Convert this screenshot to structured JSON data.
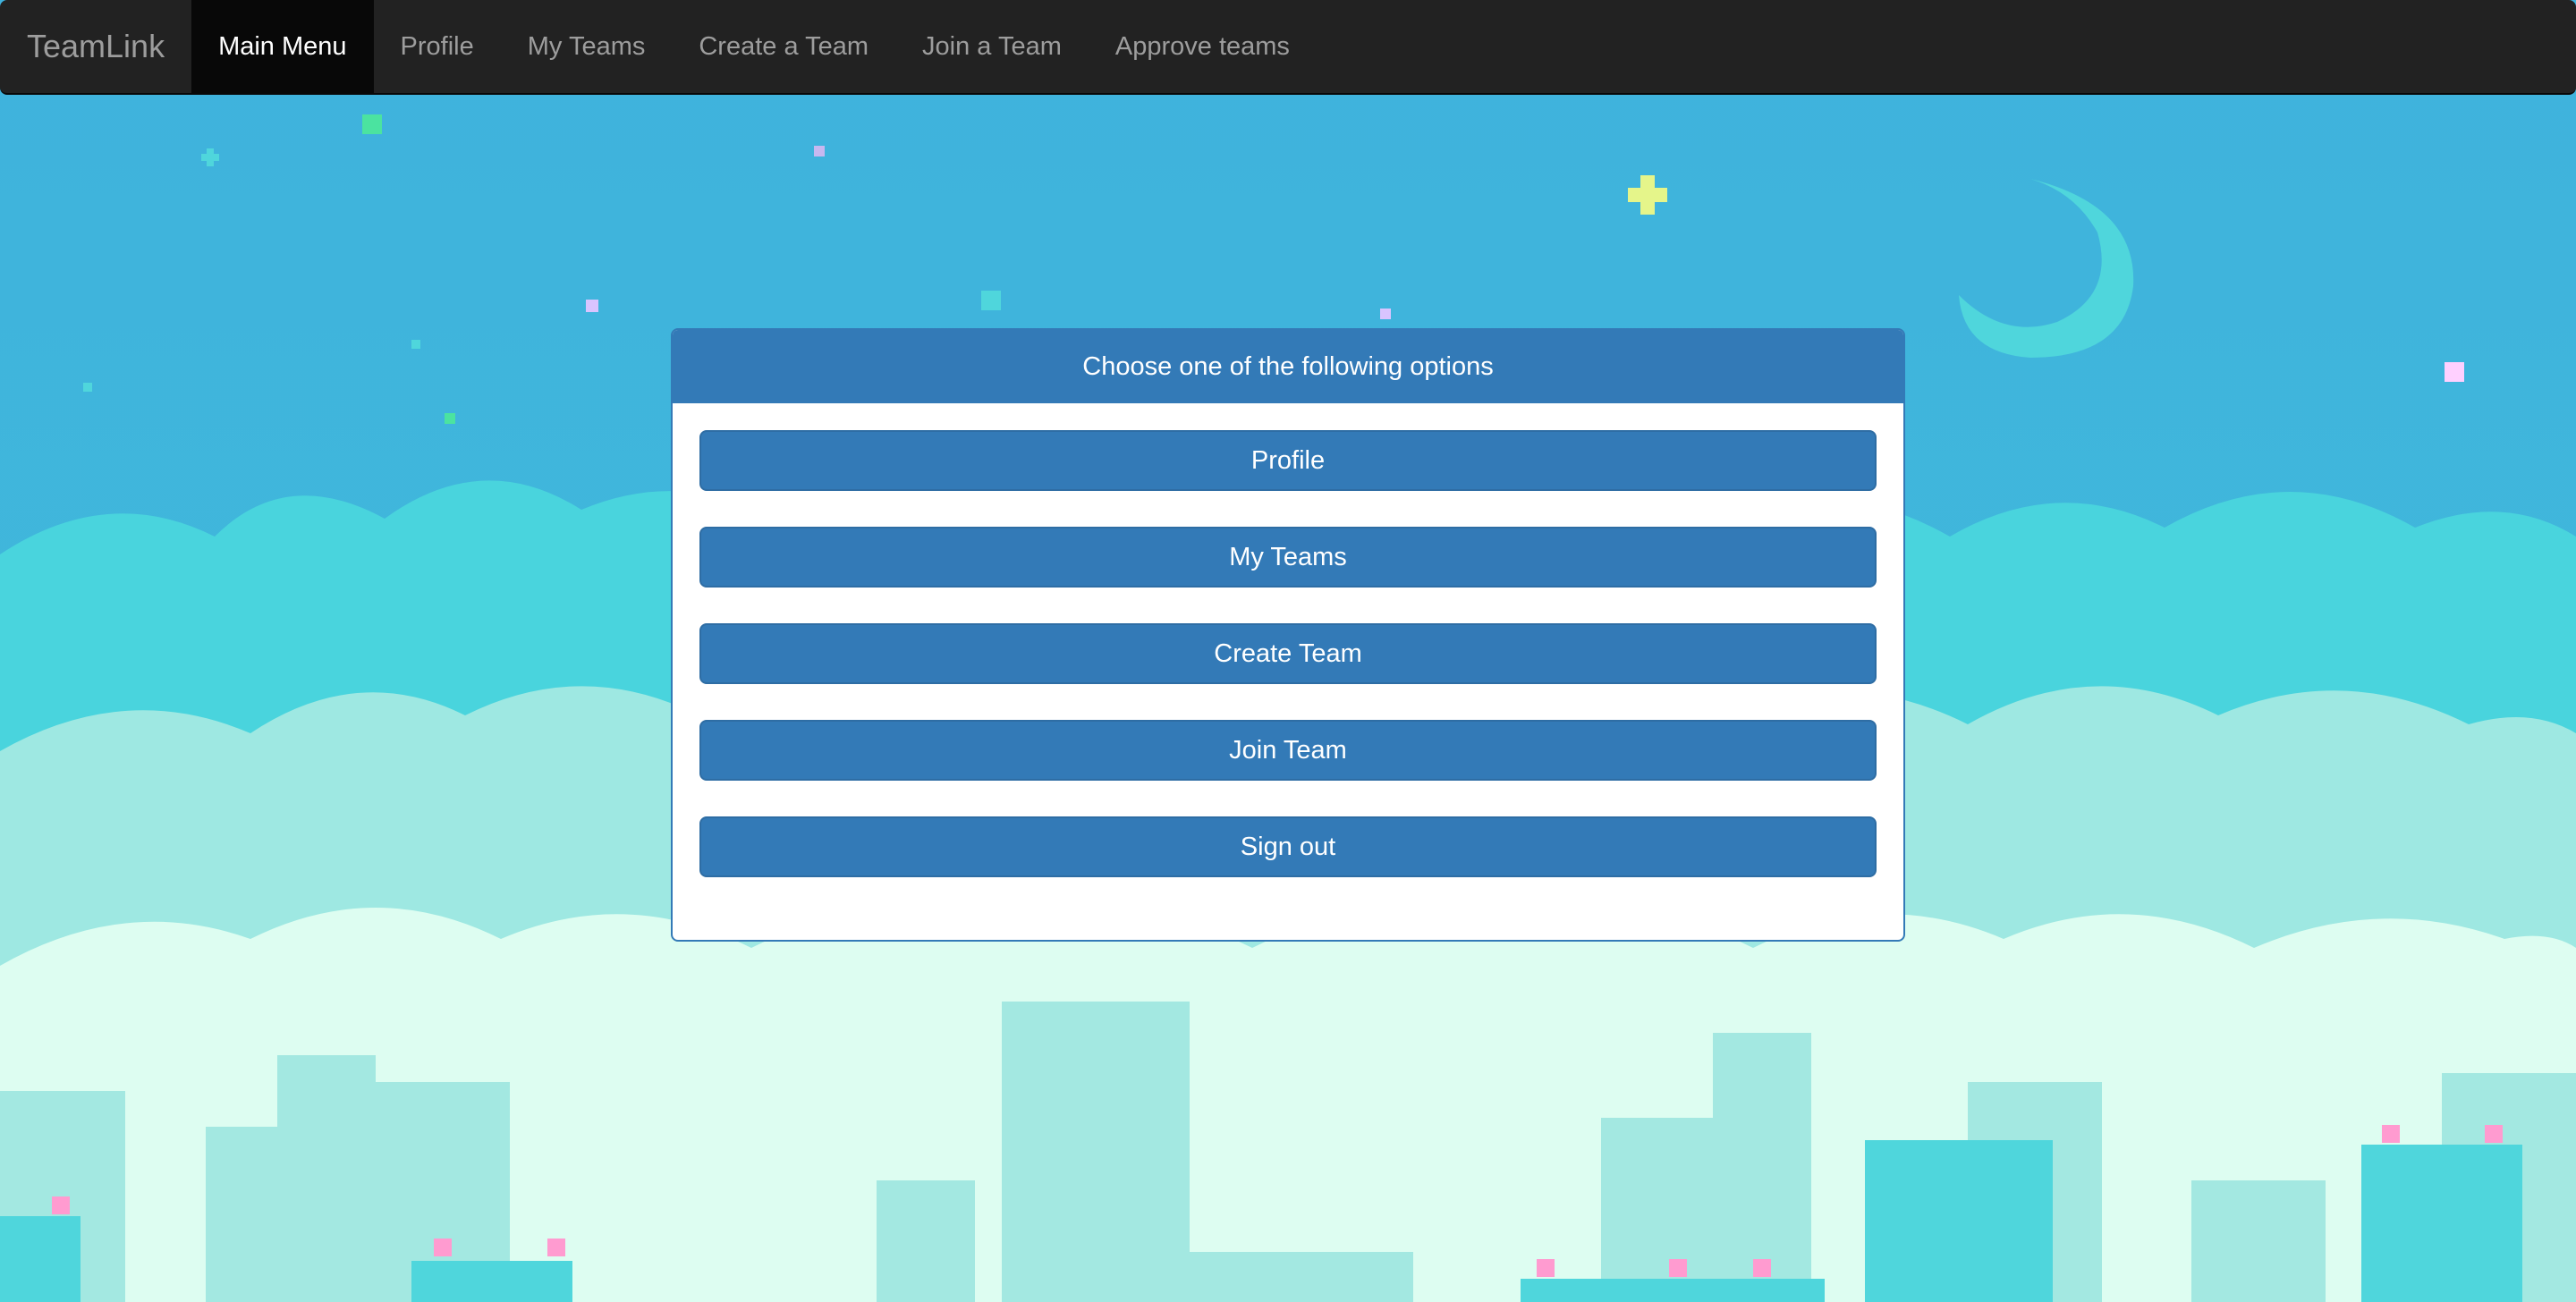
{
  "navbar": {
    "brand": "TeamLink",
    "items": [
      {
        "label": "Main Menu",
        "active": true
      },
      {
        "label": "Profile"
      },
      {
        "label": "My Teams"
      },
      {
        "label": "Create a Team"
      },
      {
        "label": "Join a Team"
      },
      {
        "label": "Approve teams"
      }
    ]
  },
  "panel": {
    "heading": "Choose one of the following options",
    "buttons": [
      {
        "label": "Profile"
      },
      {
        "label": "My Teams"
      },
      {
        "label": "Create Team"
      },
      {
        "label": "Join Team"
      },
      {
        "label": "Sign out"
      }
    ]
  },
  "colors": {
    "navbar_bg": "#222222",
    "primary": "#337ab7",
    "sky": "#40b6dc"
  }
}
